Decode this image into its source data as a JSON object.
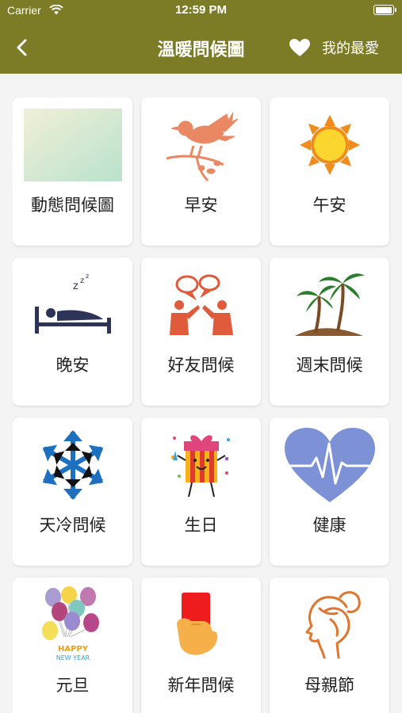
{
  "status_bar": {
    "carrier": "Carrier",
    "time": "12:59 PM",
    "battery_level": 1.0
  },
  "nav": {
    "back_icon": "chevron-left-icon",
    "title": "溫暖問候圖",
    "favorites_icon": "heart-icon",
    "favorites_label": "我的最愛"
  },
  "colors": {
    "nav_bar": "#7b7c25",
    "background": "#f4f4f4",
    "card": "#ffffff"
  },
  "categories": [
    {
      "label": "動態問候圖",
      "icon": "gradient-thumbnail"
    },
    {
      "label": "早安",
      "icon": "bird-icon"
    },
    {
      "label": "午安",
      "icon": "sun-icon"
    },
    {
      "label": "晚安",
      "icon": "sleeping-bed-icon"
    },
    {
      "label": "好友問候",
      "icon": "friends-chat-icon"
    },
    {
      "label": "週末問候",
      "icon": "palm-island-icon"
    },
    {
      "label": "天冷問候",
      "icon": "snowflake-icon"
    },
    {
      "label": "生日",
      "icon": "birthday-gift-icon"
    },
    {
      "label": "健康",
      "icon": "heartbeat-icon"
    },
    {
      "label": "元旦",
      "icon": "balloons-icon",
      "caption": [
        "HAPPY",
        "NEW YEAR"
      ]
    },
    {
      "label": "新年問候",
      "icon": "red-envelope-icon"
    },
    {
      "label": "母親節",
      "icon": "woman-profile-icon"
    }
  ]
}
